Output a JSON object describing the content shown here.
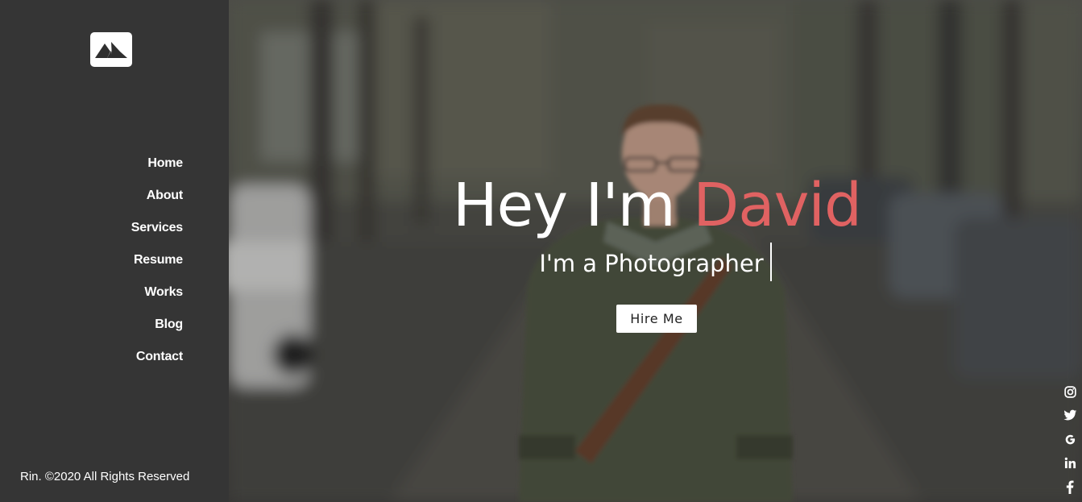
{
  "sidebar": {
    "logo_icon": "mountain-logo-icon",
    "nav": [
      {
        "label": "Home"
      },
      {
        "label": "About"
      },
      {
        "label": "Services"
      },
      {
        "label": "Resume"
      },
      {
        "label": "Works"
      },
      {
        "label": "Blog"
      },
      {
        "label": "Contact"
      }
    ],
    "copyright": "Rin. ©2020 All Rights Reserved"
  },
  "hero": {
    "greeting": "Hey I'm ",
    "name": "David",
    "subtitle": "I'm a Photographer",
    "cta_label": "Hire Me"
  },
  "social": [
    {
      "icon": "instagram-icon"
    },
    {
      "icon": "twitter-icon"
    },
    {
      "icon": "google-icon"
    },
    {
      "icon": "linkedin-icon"
    },
    {
      "icon": "facebook-icon"
    }
  ],
  "colors": {
    "sidebar_bg": "#353535",
    "accent": "#e06262",
    "text": "#ffffff"
  }
}
